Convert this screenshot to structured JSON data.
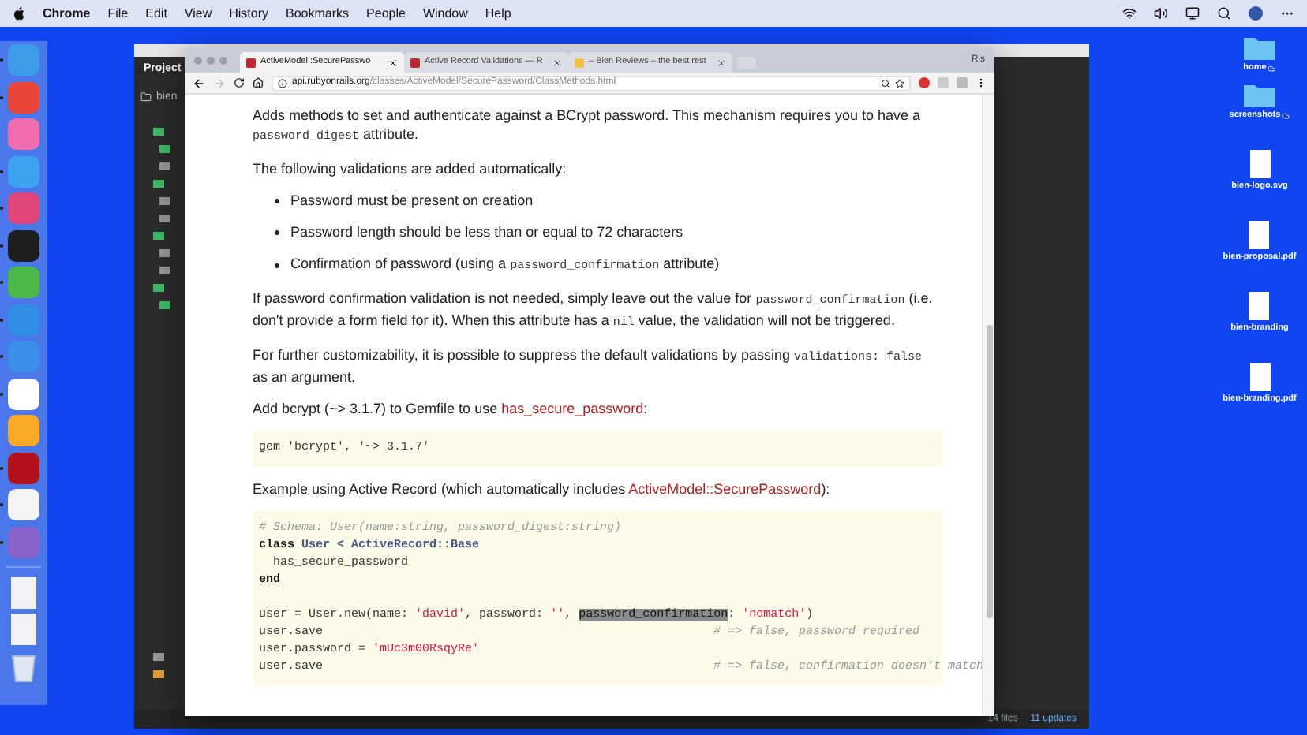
{
  "menubar": {
    "app": "Chrome",
    "menus": [
      "File",
      "Edit",
      "View",
      "History",
      "Bookmarks",
      "People",
      "Window",
      "Help"
    ]
  },
  "dock": {
    "apps": [
      {
        "color": "#3d9be9",
        "running": true
      },
      {
        "color": "#e9473b",
        "running": true
      },
      {
        "color": "#f06cae",
        "running": false
      },
      {
        "color": "#3ba4f2",
        "running": true
      },
      {
        "color": "#e0457b",
        "running": true
      },
      {
        "color": "#1e1e1e",
        "running": true
      },
      {
        "color": "#4cb848",
        "running": true
      },
      {
        "color": "#2f8de4",
        "running": true
      },
      {
        "color": "#3a8ee6",
        "running": true
      },
      {
        "color": "#ffffff",
        "running": true
      },
      {
        "color": "#f7a928",
        "running": false
      },
      {
        "color": "#b4121b",
        "running": true
      },
      {
        "color": "#f4f4f4",
        "running": true
      },
      {
        "color": "#8a63c9",
        "running": true
      }
    ],
    "documents": [
      {
        "color": "#f2f2f2"
      },
      {
        "color": "#f2f2f2"
      }
    ]
  },
  "editor": {
    "panel_title": "Project",
    "root": "bien",
    "folders": [
      {
        "color": "#3fbf6a"
      },
      {
        "color": "#3fbf6a"
      },
      {
        "color": "#9a9a9a"
      },
      {
        "color": "#3fbf6a"
      },
      {
        "color": "#9a9a9a"
      },
      {
        "color": "#9a9a9a"
      },
      {
        "color": "#3fbf6a"
      },
      {
        "color": "#9a9a9a"
      },
      {
        "color": "#9a9a9a"
      },
      {
        "color": "#3fbf6a"
      },
      {
        "color": "#3fbf6a"
      }
    ],
    "bottom_folders": [
      {
        "color": "#9a9a9a"
      },
      {
        "color": "#e8a23a"
      }
    ],
    "status_items": [
      "14 files",
      "11 updates"
    ]
  },
  "browser": {
    "tabs": [
      {
        "title": "ActiveModel::SecurePasswo",
        "selected": true
      },
      {
        "title": "Active Record Validations — R",
        "selected": false
      },
      {
        "title": "– Bien Reviews – the best rest",
        "selected": false
      }
    ],
    "profile": "Ris",
    "url": {
      "host": "api.rubyonrails.org",
      "path": "/classes/ActiveModel/SecurePassword/ClassMethods.html"
    },
    "content": [
      {
        "kind": "paragraph",
        "segments": [
          {
            "kind": "text",
            "text": "Adds methods to set and authenticate against a BCrypt password. This mechanism requires you to have a "
          },
          {
            "kind": "code",
            "text": "password_digest"
          },
          {
            "kind": "text",
            "text": " attribute."
          }
        ]
      },
      {
        "kind": "paragraph",
        "segments": [
          {
            "kind": "text",
            "text": "The following validations are added automatically:"
          }
        ]
      },
      {
        "kind": "list",
        "items": [
          [
            {
              "kind": "text",
              "text": "Password must be present on creation"
            }
          ],
          [
            {
              "kind": "text",
              "text": "Password length should be less than or equal to 72 characters"
            }
          ],
          [
            {
              "kind": "text",
              "text": "Confirmation of password (using a "
            },
            {
              "kind": "code",
              "text": "password_confirmation"
            },
            {
              "kind": "text",
              "text": " attribute)"
            }
          ]
        ]
      },
      {
        "kind": "paragraph",
        "segments": [
          {
            "kind": "text",
            "text": "If password confirmation validation is not needed, simply leave out the value for "
          },
          {
            "kind": "code",
            "text": "password_confirmation"
          },
          {
            "kind": "text",
            "text": " (i.e. don't provide a form field for it). When this attribute has a "
          },
          {
            "kind": "code",
            "text": "nil"
          },
          {
            "kind": "text",
            "text": " value, the validation will not be triggered."
          }
        ]
      },
      {
        "kind": "paragraph",
        "segments": [
          {
            "kind": "text",
            "text": "For further customizability, it is possible to suppress the default validations by passing "
          },
          {
            "kind": "code",
            "text": "validations: false"
          },
          {
            "kind": "text",
            "text": " as an argument."
          }
        ]
      },
      {
        "kind": "paragraph",
        "segments": [
          {
            "kind": "text",
            "text": "Add bcrypt (~> 3.1.7) to Gemfile to use "
          },
          {
            "kind": "link",
            "text": "has_secure_password"
          },
          {
            "kind": "text",
            "text": ":"
          }
        ]
      },
      {
        "kind": "codeblock",
        "lines": [
          {
            "kind": "code",
            "segments": [
              {
                "kind": "plain",
                "text": "gem 'bcrypt', '~> 3.1.7'"
              }
            ]
          }
        ]
      },
      {
        "kind": "paragraph",
        "segments": [
          {
            "kind": "text",
            "text": "Example using Active Record (which automatically includes "
          },
          {
            "kind": "link",
            "text": "ActiveModel::SecurePassword"
          },
          {
            "kind": "text",
            "text": "):"
          }
        ]
      },
      {
        "kind": "codeblock",
        "lines": [
          {
            "kind": "code",
            "segments": [
              {
                "kind": "comment",
                "text": "# Schema: User(name:string, password_digest:string)"
              }
            ]
          },
          {
            "kind": "code",
            "segments": [
              {
                "kind": "keyword",
                "text": "class"
              },
              {
                "kind": "const",
                "text": " User < ActiveRecord::Base"
              }
            ]
          },
          {
            "kind": "code",
            "segments": [
              {
                "kind": "plain",
                "text": "  has_secure_password"
              }
            ]
          },
          {
            "kind": "code",
            "segments": [
              {
                "kind": "keyword",
                "text": "end"
              }
            ]
          },
          {
            "kind": "blank"
          },
          {
            "kind": "code",
            "segments": [
              {
                "kind": "plain",
                "text": "user = User.new(name: "
              },
              {
                "kind": "string",
                "text": "'david'"
              },
              {
                "kind": "plain",
                "text": ", password: "
              },
              {
                "kind": "string",
                "text": "''"
              },
              {
                "kind": "plain",
                "text": ", "
              },
              {
                "kind": "highlight",
                "text": "password_confirmation"
              },
              {
                "kind": "plain",
                "text": ": "
              },
              {
                "kind": "string",
                "text": "'nomatch'"
              },
              {
                "kind": "plain",
                "text": ")"
              }
            ]
          },
          {
            "kind": "code",
            "segments": [
              {
                "kind": "plain",
                "text": "user.save"
              }
            ],
            "comment": "# => false, password required"
          },
          {
            "kind": "code",
            "segments": [
              {
                "kind": "plain",
                "text": "user.password = "
              },
              {
                "kind": "string",
                "text": "'mUc3m00RsqyRe'"
              }
            ]
          },
          {
            "kind": "code",
            "segments": [
              {
                "kind": "plain",
                "text": "user.save"
              }
            ],
            "comment": "# => false, confirmation doesn't match"
          }
        ]
      }
    ]
  },
  "desktop_icons": [
    {
      "kind": "folder",
      "label": "home",
      "synced": true
    },
    {
      "kind": "folder",
      "label": "screenshots",
      "synced": true
    },
    {
      "kind": "file",
      "label": "bien-logo.svg"
    },
    {
      "kind": "file",
      "label": "bien-proposal.pdf"
    },
    {
      "kind": "file",
      "label": "bien-branding"
    },
    {
      "kind": "file",
      "label": "bien-branding.pdf"
    }
  ]
}
